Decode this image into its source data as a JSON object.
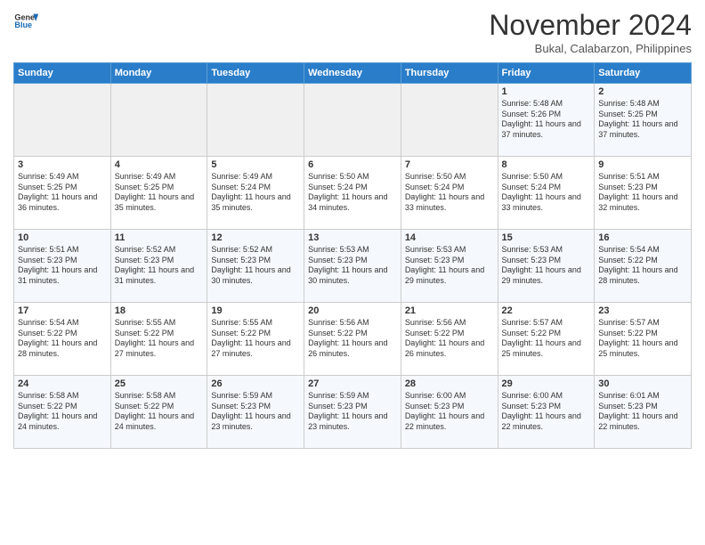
{
  "header": {
    "logo_line1": "General",
    "logo_line2": "Blue",
    "month": "November 2024",
    "location": "Bukal, Calabarzon, Philippines"
  },
  "weekdays": [
    "Sunday",
    "Monday",
    "Tuesday",
    "Wednesday",
    "Thursday",
    "Friday",
    "Saturday"
  ],
  "weeks": [
    [
      {
        "day": "",
        "info": ""
      },
      {
        "day": "",
        "info": ""
      },
      {
        "day": "",
        "info": ""
      },
      {
        "day": "",
        "info": ""
      },
      {
        "day": "",
        "info": ""
      },
      {
        "day": "1",
        "info": "Sunrise: 5:48 AM\nSunset: 5:26 PM\nDaylight: 11 hours and 37 minutes."
      },
      {
        "day": "2",
        "info": "Sunrise: 5:48 AM\nSunset: 5:25 PM\nDaylight: 11 hours and 37 minutes."
      }
    ],
    [
      {
        "day": "3",
        "info": "Sunrise: 5:49 AM\nSunset: 5:25 PM\nDaylight: 11 hours and 36 minutes."
      },
      {
        "day": "4",
        "info": "Sunrise: 5:49 AM\nSunset: 5:25 PM\nDaylight: 11 hours and 35 minutes."
      },
      {
        "day": "5",
        "info": "Sunrise: 5:49 AM\nSunset: 5:24 PM\nDaylight: 11 hours and 35 minutes."
      },
      {
        "day": "6",
        "info": "Sunrise: 5:50 AM\nSunset: 5:24 PM\nDaylight: 11 hours and 34 minutes."
      },
      {
        "day": "7",
        "info": "Sunrise: 5:50 AM\nSunset: 5:24 PM\nDaylight: 11 hours and 33 minutes."
      },
      {
        "day": "8",
        "info": "Sunrise: 5:50 AM\nSunset: 5:24 PM\nDaylight: 11 hours and 33 minutes."
      },
      {
        "day": "9",
        "info": "Sunrise: 5:51 AM\nSunset: 5:23 PM\nDaylight: 11 hours and 32 minutes."
      }
    ],
    [
      {
        "day": "10",
        "info": "Sunrise: 5:51 AM\nSunset: 5:23 PM\nDaylight: 11 hours and 31 minutes."
      },
      {
        "day": "11",
        "info": "Sunrise: 5:52 AM\nSunset: 5:23 PM\nDaylight: 11 hours and 31 minutes."
      },
      {
        "day": "12",
        "info": "Sunrise: 5:52 AM\nSunset: 5:23 PM\nDaylight: 11 hours and 30 minutes."
      },
      {
        "day": "13",
        "info": "Sunrise: 5:53 AM\nSunset: 5:23 PM\nDaylight: 11 hours and 30 minutes."
      },
      {
        "day": "14",
        "info": "Sunrise: 5:53 AM\nSunset: 5:23 PM\nDaylight: 11 hours and 29 minutes."
      },
      {
        "day": "15",
        "info": "Sunrise: 5:53 AM\nSunset: 5:23 PM\nDaylight: 11 hours and 29 minutes."
      },
      {
        "day": "16",
        "info": "Sunrise: 5:54 AM\nSunset: 5:22 PM\nDaylight: 11 hours and 28 minutes."
      }
    ],
    [
      {
        "day": "17",
        "info": "Sunrise: 5:54 AM\nSunset: 5:22 PM\nDaylight: 11 hours and 28 minutes."
      },
      {
        "day": "18",
        "info": "Sunrise: 5:55 AM\nSunset: 5:22 PM\nDaylight: 11 hours and 27 minutes."
      },
      {
        "day": "19",
        "info": "Sunrise: 5:55 AM\nSunset: 5:22 PM\nDaylight: 11 hours and 27 minutes."
      },
      {
        "day": "20",
        "info": "Sunrise: 5:56 AM\nSunset: 5:22 PM\nDaylight: 11 hours and 26 minutes."
      },
      {
        "day": "21",
        "info": "Sunrise: 5:56 AM\nSunset: 5:22 PM\nDaylight: 11 hours and 26 minutes."
      },
      {
        "day": "22",
        "info": "Sunrise: 5:57 AM\nSunset: 5:22 PM\nDaylight: 11 hours and 25 minutes."
      },
      {
        "day": "23",
        "info": "Sunrise: 5:57 AM\nSunset: 5:22 PM\nDaylight: 11 hours and 25 minutes."
      }
    ],
    [
      {
        "day": "24",
        "info": "Sunrise: 5:58 AM\nSunset: 5:22 PM\nDaylight: 11 hours and 24 minutes."
      },
      {
        "day": "25",
        "info": "Sunrise: 5:58 AM\nSunset: 5:22 PM\nDaylight: 11 hours and 24 minutes."
      },
      {
        "day": "26",
        "info": "Sunrise: 5:59 AM\nSunset: 5:23 PM\nDaylight: 11 hours and 23 minutes."
      },
      {
        "day": "27",
        "info": "Sunrise: 5:59 AM\nSunset: 5:23 PM\nDaylight: 11 hours and 23 minutes."
      },
      {
        "day": "28",
        "info": "Sunrise: 6:00 AM\nSunset: 5:23 PM\nDaylight: 11 hours and 22 minutes."
      },
      {
        "day": "29",
        "info": "Sunrise: 6:00 AM\nSunset: 5:23 PM\nDaylight: 11 hours and 22 minutes."
      },
      {
        "day": "30",
        "info": "Sunrise: 6:01 AM\nSunset: 5:23 PM\nDaylight: 11 hours and 22 minutes."
      }
    ]
  ]
}
